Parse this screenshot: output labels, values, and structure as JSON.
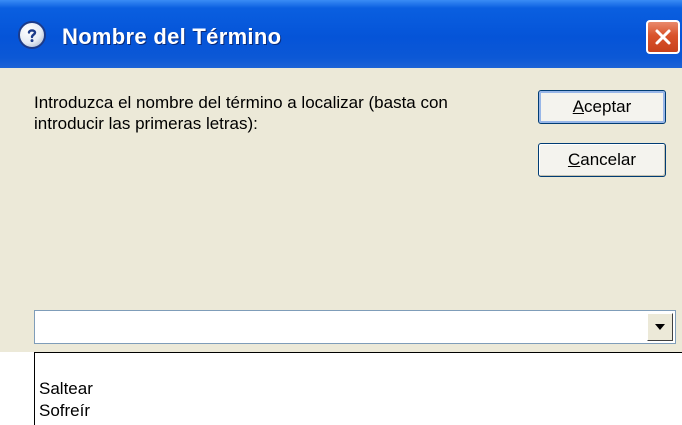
{
  "dialog": {
    "title": "Nombre del Término",
    "message": "Introduzca el nombre del término a localizar (basta con introducir las primeras letras):"
  },
  "buttons": {
    "accept": {
      "accel": "A",
      "rest": "ceptar"
    },
    "cancel": {
      "accel": "C",
      "rest": "ancelar"
    }
  },
  "combo": {
    "value": ""
  },
  "dropdown": {
    "items": [
      {
        "label": "Saltear"
      },
      {
        "label": "Sofreír"
      }
    ]
  },
  "colors": {
    "titlebar": "#0554d8",
    "dialog_bg": "#ece9d8",
    "close_button": "#d9532b"
  },
  "icons": {
    "title": "help-question-icon",
    "close": "close-icon",
    "dropdown": "chevron-down-icon"
  }
}
